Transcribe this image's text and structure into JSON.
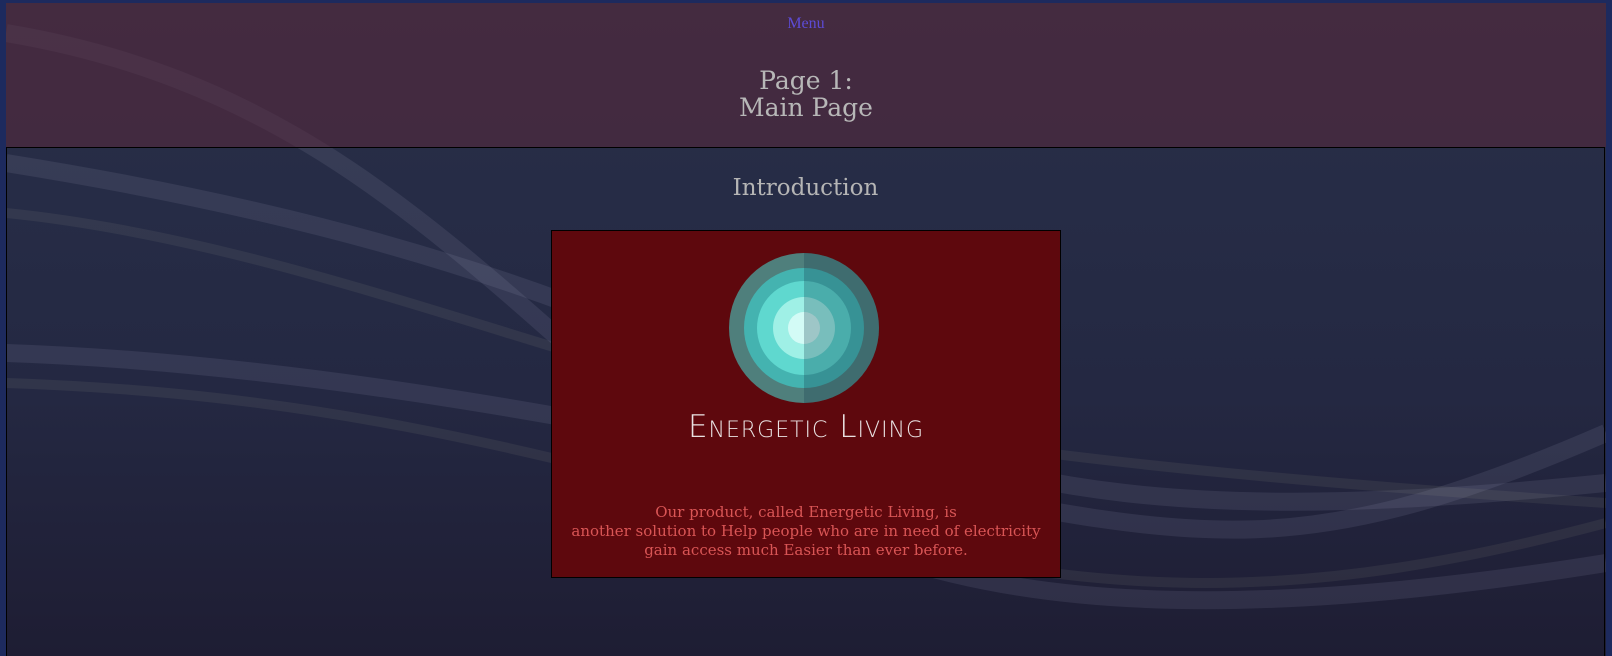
{
  "header": {
    "menu_label": "Menu",
    "title_line1": "Page 1:",
    "title_line2": "Main Page"
  },
  "main": {
    "section_title": "Introduction",
    "card": {
      "logo_icon": "concentric-circles-icon",
      "brand_name": "Energetic Living",
      "description_lines": [
        "Our product, called Energetic Living, is",
        "another solution to Help people who are in need of electricity",
        "gain access much Easier than ever before."
      ]
    }
  },
  "colors": {
    "outer_background": "#1d2a5e",
    "header_tint": "#5a283c",
    "card_background": "#5e080d",
    "menu_link": "#5d4bd6",
    "description_text": "#d95555",
    "logo_teal": "#2ccbd0"
  }
}
